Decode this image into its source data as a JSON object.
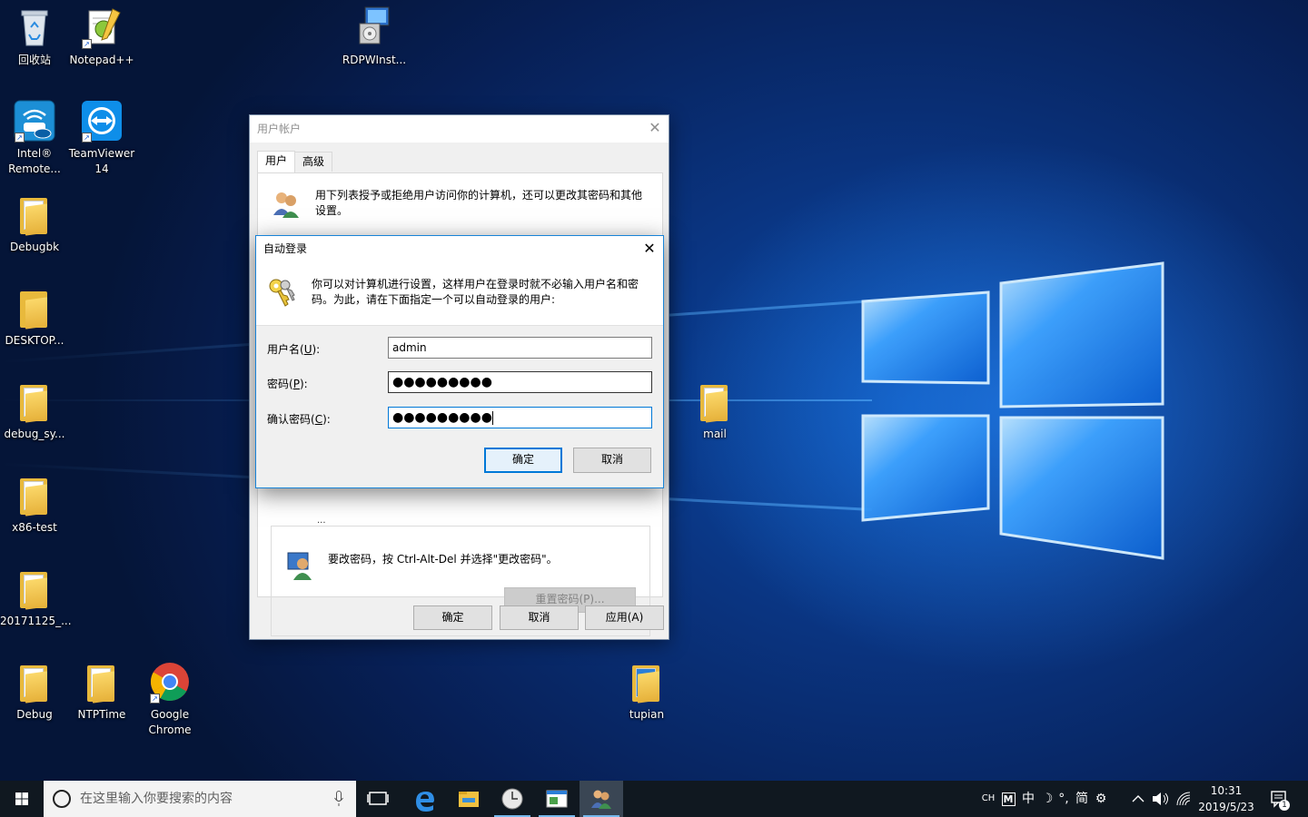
{
  "desktop": {
    "icons": [
      {
        "label": "回收站"
      },
      {
        "label": "Notepad++"
      },
      {
        "label": "RDPWInst..."
      },
      {
        "label": "Intel®\nRemote..."
      },
      {
        "label": "TeamViewer\n14"
      },
      {
        "label": "Debugbk"
      },
      {
        "label": "DESKTOP..."
      },
      {
        "label": "debug_sy..."
      },
      {
        "label": "x86-test"
      },
      {
        "label": "20171125_..."
      },
      {
        "label": "Debug"
      },
      {
        "label": "NTPTime"
      },
      {
        "label": "Google\nChrome"
      },
      {
        "label": "mail"
      },
      {
        "label": "tupian"
      }
    ]
  },
  "user_accounts": {
    "title": "用户帐户",
    "tabs": [
      "用户",
      "高级"
    ],
    "description": "用下列表授予或拒绝用户访问你的计算机，还可以更改其密码和其他设置。",
    "clipped_text": "...",
    "change_password_text": "要改密码，按 Ctrl-Alt-Del 并选择\"更改密码\"。",
    "reset_password_button": "重置密码(P)...",
    "ok_button": "确定",
    "cancel_button": "取消",
    "apply_button": "应用(A)"
  },
  "auto_logon": {
    "title": "自动登录",
    "description": "你可以对计算机进行设置，这样用户在登录时就不必输入用户名和密码。为此，请在下面指定一个可以自动登录的用户:",
    "username_label": "用户名",
    "username_key": "U",
    "username_value": "admin",
    "password_label": "密码",
    "password_key": "P",
    "password_value": "●●●●●●●●●",
    "confirm_label": "确认密码",
    "confirm_key": "C",
    "confirm_value": "●●●●●●●●●",
    "ok_button": "确定",
    "cancel_button": "取消"
  },
  "taskbar": {
    "search_placeholder": "在这里输入你要搜索的内容",
    "tray": {
      "ime_lang": "CH",
      "ime_mode": "中",
      "ime_extra": "简",
      "time": "10:31",
      "date": "2019/5/23",
      "notification_count": "1"
    }
  },
  "colors": {
    "accent": "#0078d7",
    "taskbar": "#101820",
    "wallpaper": "#0a3582"
  }
}
